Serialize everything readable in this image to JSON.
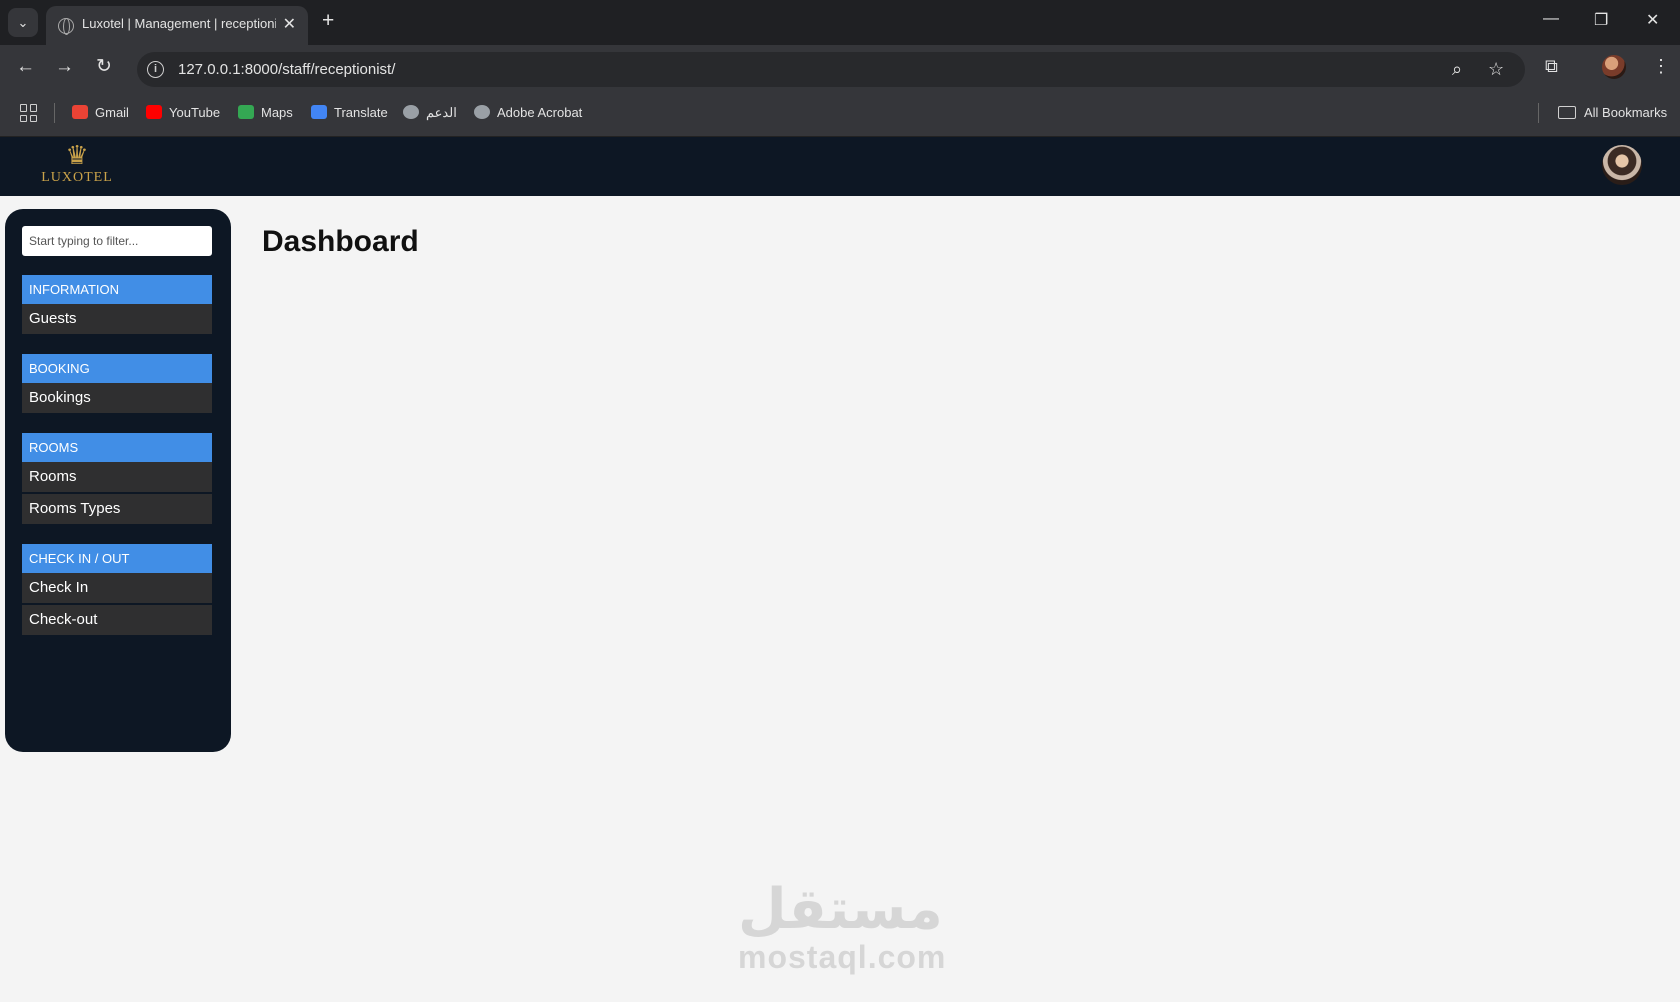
{
  "browser": {
    "tab_title": "Luxotel | Management | receptionist",
    "url": "127.0.0.1:8000/staff/receptionist/",
    "bookmarks": [
      {
        "label": "Gmail",
        "color": "#ea4335"
      },
      {
        "label": "YouTube",
        "color": "#ff0000"
      },
      {
        "label": "Maps",
        "color": "#34a853"
      },
      {
        "label": "Translate",
        "color": "#4285f4"
      },
      {
        "label": "الدعم",
        "color": "#9aa0a6"
      },
      {
        "label": "Adobe Acrobat",
        "color": "#9aa0a6"
      }
    ],
    "all_bookmarks": "All Bookmarks"
  },
  "header": {
    "logo_text": "LUXOTEL",
    "brand_color": "#c9a24a",
    "background": "#0d1724"
  },
  "sidebar": {
    "filter_placeholder": "Start typing to filter...",
    "accent_color": "#418ee6",
    "sections": [
      {
        "title": "INFORMATION",
        "items": [
          "Guests"
        ]
      },
      {
        "title": "BOOKING",
        "items": [
          "Bookings"
        ]
      },
      {
        "title": "ROOMS",
        "items": [
          "Rooms",
          "Rooms Types"
        ]
      },
      {
        "title": "CHECK IN / OUT",
        "items": [
          "Check In",
          "Check-out"
        ]
      }
    ]
  },
  "main": {
    "title": "Dashboard"
  },
  "watermark": {
    "arabic": "مستقل",
    "latin": "mostaql.com"
  }
}
